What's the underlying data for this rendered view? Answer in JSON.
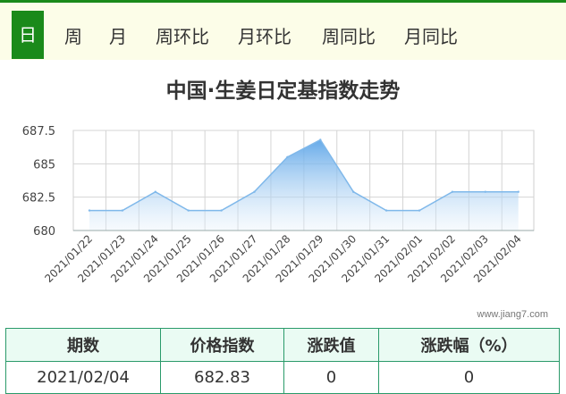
{
  "tabs": [
    {
      "label": "日",
      "active": true
    },
    {
      "label": "周",
      "active": false
    },
    {
      "label": "月",
      "active": false
    },
    {
      "label": "周环比",
      "active": false
    },
    {
      "label": "月环比",
      "active": false
    },
    {
      "label": "周同比",
      "active": false
    },
    {
      "label": "月同比",
      "active": false
    }
  ],
  "colors": {
    "accent": "#1a8a1a",
    "line": "#7fb8ea",
    "table_border": "#2a9a6a"
  },
  "chart_data": {
    "type": "area",
    "title": "中国·生姜日定基指数走势",
    "categories": [
      "2021/01/22",
      "2021/01/23",
      "2021/01/24",
      "2021/01/25",
      "2021/01/26",
      "2021/01/27",
      "2021/01/28",
      "2021/01/29",
      "2021/01/30",
      "2021/01/31",
      "2021/02/01",
      "2021/02/02",
      "2021/02/03",
      "2021/02/04"
    ],
    "values": [
      681.5,
      681.5,
      682.9,
      681.5,
      681.5,
      682.9,
      685.5,
      686.8,
      682.9,
      681.5,
      681.5,
      682.9,
      682.9,
      682.9
    ],
    "ylim": [
      680,
      687.5
    ],
    "yticks": [
      "680",
      "682.5",
      "685",
      "687.5"
    ],
    "grid": true
  },
  "watermark": "www.jiang7.com",
  "table": {
    "headers": [
      "期数",
      "价格指数",
      "涨跌值",
      "涨跌幅（%）"
    ],
    "row": [
      "2021/02/04",
      "682.83",
      "0",
      "0"
    ]
  }
}
